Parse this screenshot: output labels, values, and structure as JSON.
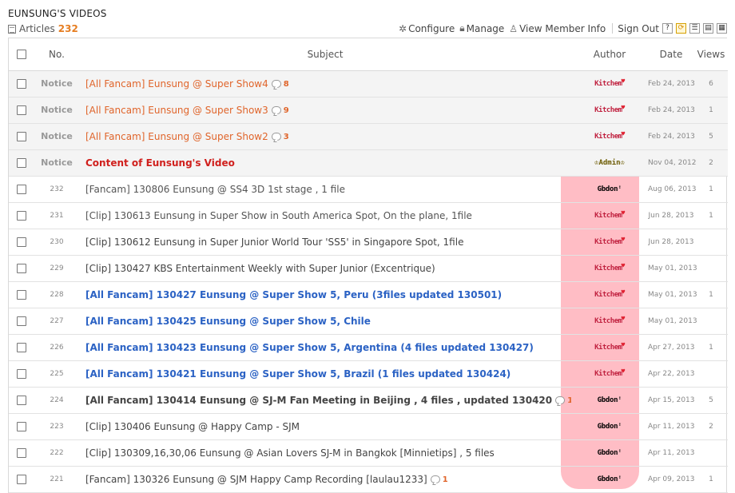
{
  "board": {
    "title": "EUNSUNG'S VIDEOS",
    "articles_label": "Articles",
    "articles_count": "232"
  },
  "toolbar": {
    "configure": "Configure",
    "manage": "Manage",
    "view_member_info": "View Member Info",
    "sign_out": "Sign Out",
    "help": "?"
  },
  "headers": {
    "no": "No.",
    "subject": "Subject",
    "author": "Author",
    "date": "Date",
    "views": "Views"
  },
  "rows": [
    {
      "no": "Notice",
      "subject": "[All Fancam] Eunsung @ Super Show4",
      "comments": "8",
      "author": "Kitchem",
      "date": "Feb 24, 2013",
      "views": "6"
    },
    {
      "no": "Notice",
      "subject": "[All Fancam] Eunsung @ Super Show3",
      "comments": "9",
      "author": "Kitchem",
      "date": "Feb 24, 2013",
      "views": "1"
    },
    {
      "no": "Notice",
      "subject": "[All Fancam] Eunsung @ Super Show2",
      "comments": "3",
      "author": "Kitchem",
      "date": "Feb 24, 2013",
      "views": "5"
    },
    {
      "no": "Notice",
      "subject": "Content of Eunsung's Video",
      "comments": "",
      "author": "Admin",
      "date": "Nov 04, 2012",
      "views": "2"
    },
    {
      "no": "232",
      "subject": "[Fancam] 130806 Eunsung @ SS4 3D 1st stage , 1 file",
      "comments": "",
      "author": "Gbdon",
      "date": "Aug 06, 2013",
      "views": "1"
    },
    {
      "no": "231",
      "subject": "[Clip] 130613 Eunsung in Super Show in South America Spot, On the plane, 1file",
      "comments": "",
      "author": "Kitchem",
      "date": "Jun 28, 2013",
      "views": "1"
    },
    {
      "no": "230",
      "subject": "[Clip] 130612 Eunsung in Super Junior World Tour 'SS5' in Singapore Spot, 1file",
      "comments": "",
      "author": "Kitchem",
      "date": "Jun 28, 2013",
      "views": ""
    },
    {
      "no": "229",
      "subject": "[Clip] 130427 KBS Entertainment Weekly with Super Junior (Excentrique)",
      "comments": "",
      "author": "Kitchem",
      "date": "May 01, 2013",
      "views": ""
    },
    {
      "no": "228",
      "subject": "[All Fancam] 130427 Eunsung @ Super Show 5, Peru (3files updated 130501)",
      "comments": "",
      "author": "Kitchem",
      "date": "May 01, 2013",
      "views": "1"
    },
    {
      "no": "227",
      "subject": "[All Fancam] 130425 Eunsung @ Super Show 5, Chile",
      "comments": "",
      "author": "Kitchem",
      "date": "May 01, 2013",
      "views": ""
    },
    {
      "no": "226",
      "subject": "[All Fancam] 130423 Eunsung @ Super Show 5, Argentina (4 files updated 130427)",
      "comments": "",
      "author": "Kitchem",
      "date": "Apr 27, 2013",
      "views": "1"
    },
    {
      "no": "225",
      "subject": "[All Fancam] 130421 Eunsung @ Super Show 5, Brazil (1 files updated 130424)",
      "comments": "",
      "author": "Kitchem",
      "date": "Apr 22, 2013",
      "views": ""
    },
    {
      "no": "224",
      "subject": "[All Fancam] 130414 Eunsung @ SJ-M Fan Meeting in Beijing , 4 files , updated 130420",
      "comments": "1",
      "author": "Gbdon",
      "date": "Apr 15, 2013",
      "views": "5"
    },
    {
      "no": "223",
      "subject": "[Clip] 130406 Eunsung @ Happy Camp - SJM",
      "comments": "",
      "author": "Gbdon",
      "date": "Apr 11, 2013",
      "views": "2"
    },
    {
      "no": "222",
      "subject": "[Clip] 130309,16,30,06 Eunsung @ Asian Lovers SJ-M in Bangkok [Minnietips] , 5 files",
      "comments": "",
      "author": "Gbdon",
      "date": "Apr 11, 2013",
      "views": ""
    },
    {
      "no": "221",
      "subject": "[Fancam] 130326 Eunsung @ SJM Happy Camp Recording [laulau1233]",
      "comments": "1",
      "author": "Gbdon",
      "date": "Apr 09, 2013",
      "views": "1"
    }
  ]
}
